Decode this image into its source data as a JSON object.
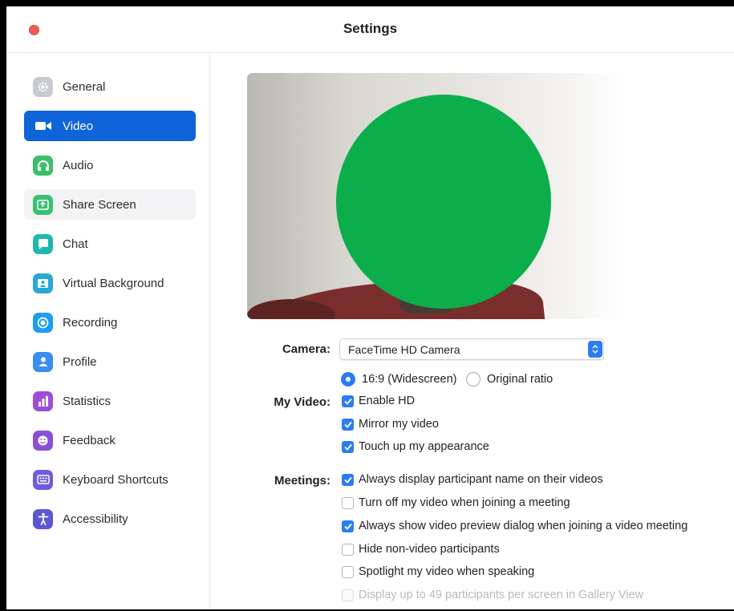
{
  "window": {
    "title": "Settings"
  },
  "sidebar": {
    "items": [
      {
        "label": "General",
        "icon": "gear-icon",
        "color": "#c9cbd0"
      },
      {
        "label": "Video",
        "icon": "video-camera-icon",
        "color": "#0e64d8",
        "active": true
      },
      {
        "label": "Audio",
        "icon": "headphones-icon",
        "color": "#3bbf6a"
      },
      {
        "label": "Share Screen",
        "icon": "share-screen-icon",
        "color": "#39c173",
        "hover": true
      },
      {
        "label": "Chat",
        "icon": "chat-bubble-icon",
        "color": "#1fb7b0"
      },
      {
        "label": "Virtual Background",
        "icon": "virtual-background-icon",
        "color": "#25a8d9"
      },
      {
        "label": "Recording",
        "icon": "recording-icon",
        "color": "#1e9cf2"
      },
      {
        "label": "Profile",
        "icon": "profile-icon",
        "color": "#3b8df0"
      },
      {
        "label": "Statistics",
        "icon": "statistics-icon",
        "color": "#9b4dd6"
      },
      {
        "label": "Feedback",
        "icon": "feedback-smiley-icon",
        "color": "#8a4fd8"
      },
      {
        "label": "Keyboard Shortcuts",
        "icon": "keyboard-icon",
        "color": "#6d5ce3"
      },
      {
        "label": "Accessibility",
        "icon": "accessibility-icon",
        "color": "#5a56d6"
      }
    ]
  },
  "video": {
    "camera_label": "Camera:",
    "camera_value": "FaceTime HD Camera",
    "my_video_label": "My Video:",
    "aspect_widescreen": "16:9 (Widescreen)",
    "aspect_original": "Original ratio",
    "enable_hd": "Enable HD",
    "mirror": "Mirror my video",
    "touch_up": "Touch up my appearance",
    "meetings_label": "Meetings:",
    "meeting_options": [
      {
        "label": "Always display participant name on their videos",
        "checked": true
      },
      {
        "label": "Turn off my video when joining a meeting",
        "checked": false
      },
      {
        "label": "Always show video preview dialog when joining a video meeting",
        "checked": true
      },
      {
        "label": "Hide non-video participants",
        "checked": false
      },
      {
        "label": "Spotlight my video when speaking",
        "checked": false
      },
      {
        "label": "Display up to 49 participants per screen in Gallery View",
        "checked": false,
        "disabled": true
      }
    ]
  },
  "colors": {
    "accent": "#0e64d8",
    "checkbox": "#2c7cf2",
    "mask": "#0bae4b"
  }
}
